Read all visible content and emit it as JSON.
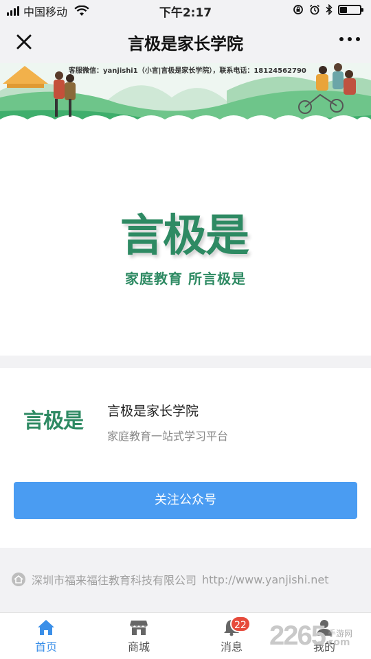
{
  "status_bar": {
    "carrier": "中国移动",
    "time": "下午2:17",
    "battery_level": 0.35
  },
  "nav": {
    "title": "言极是家长学院"
  },
  "banner": {
    "contact_text": "客服微信：yanjishi1（小言|言极是家长学院），联系电话：18124562790"
  },
  "brand": {
    "logo_text": "言极是",
    "slogan": "家庭教育  所言极是",
    "primary_color": "#2e8a63"
  },
  "card": {
    "logo_text": "言极是",
    "name": "言极是家长学院",
    "description": "家庭教育一站式学习平台",
    "follow_label": "关注公众号",
    "button_color": "#4a9cf2"
  },
  "footer": {
    "company": "深圳市福来福往教育科技有限公司",
    "url": "http://www.yanjishi.net"
  },
  "tabs": [
    {
      "label": "首页",
      "icon": "home-icon",
      "active": true
    },
    {
      "label": "商城",
      "icon": "shop-icon",
      "active": false
    },
    {
      "label": "消息",
      "icon": "bell-icon",
      "active": false,
      "badge": "22"
    },
    {
      "label": "我的",
      "icon": "user-icon",
      "active": false
    }
  ],
  "watermark": {
    "number": "2265",
    "site_cn": "手游网",
    "site_com": "com"
  }
}
